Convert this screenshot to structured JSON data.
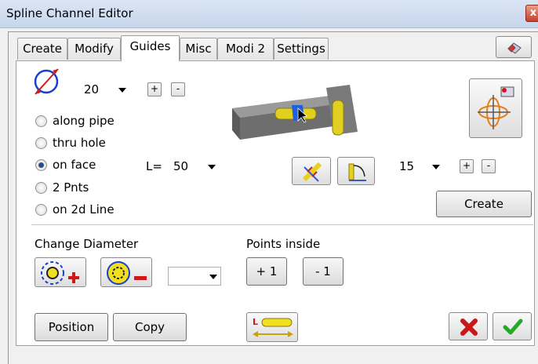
{
  "window": {
    "title": "Spline Channel Editor",
    "close_glyph": "x"
  },
  "tabs": [
    {
      "label": "Create"
    },
    {
      "label": "Modify"
    },
    {
      "label": "Guides",
      "active": true
    },
    {
      "label": "Misc"
    },
    {
      "label": "Modi 2"
    },
    {
      "label": "Settings"
    }
  ],
  "top": {
    "diameter_value": "20",
    "plus": "+",
    "minus": "-"
  },
  "radios": [
    {
      "label": "along pipe",
      "checked": false
    },
    {
      "label": "thru hole",
      "checked": false
    },
    {
      "label": "on face",
      "checked": true
    },
    {
      "label": "2 Pnts",
      "checked": false
    },
    {
      "label": "on 2d Line",
      "checked": false
    }
  ],
  "length": {
    "label": "L=",
    "value": "50"
  },
  "angle": {
    "value": "15",
    "plus": "+",
    "minus": "-"
  },
  "create_button": "Create",
  "change_diameter": {
    "title": "Change Diameter",
    "value": ""
  },
  "points_inside": {
    "title": "Points inside",
    "plus_label": "+ 1",
    "minus_label": "- 1"
  },
  "bottom": {
    "position_label": "Position",
    "copy_label": "Copy"
  },
  "icons": {
    "eraser": "eraser-icon",
    "diameter": "diameter-icon",
    "orientation": "orientation-gizmo-icon",
    "preview": "model-preview-image",
    "cross_pipes": "cross-pipes-icon",
    "bend_angle": "bend-angle-icon",
    "increase_diameter": "increase-diameter-icon",
    "decrease_diameter": "decrease-diameter-icon",
    "length_measure": "length-measure-icon",
    "cancel": "cancel-x-icon",
    "ok": "ok-check-icon"
  },
  "colors": {
    "accent_blue": "#1a3fd0",
    "red": "#d01818",
    "yellow": "#f0e020",
    "green": "#28a828"
  }
}
